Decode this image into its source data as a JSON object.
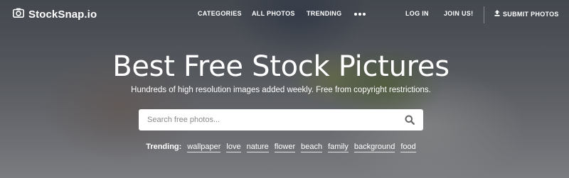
{
  "brand": {
    "name": "StockSnap.io",
    "icon": "camera-icon"
  },
  "nav": {
    "categories": "CATEGORIES",
    "all_photos": "ALL PHOTOS",
    "trending": "TRENDING",
    "more_icon": "more-dots-icon",
    "login": "LOG IN",
    "join": "JOIN US!",
    "submit": "SUBMIT PHOTOS",
    "submit_icon": "upload-icon"
  },
  "hero": {
    "title": "Best Free Stock Pictures",
    "subtitle": "Hundreds of high resolution images added weekly. Free from copyright restrictions."
  },
  "search": {
    "placeholder": "Search free photos...",
    "value": "",
    "icon": "search-icon"
  },
  "trending": {
    "label": "Trending:",
    "tags": [
      "wallpaper",
      "love",
      "nature",
      "flower",
      "beach",
      "family",
      "background",
      "food"
    ]
  },
  "colors": {
    "text": "#ffffff",
    "search_bg": "#ffffff",
    "placeholder": "#8a8a8a"
  }
}
